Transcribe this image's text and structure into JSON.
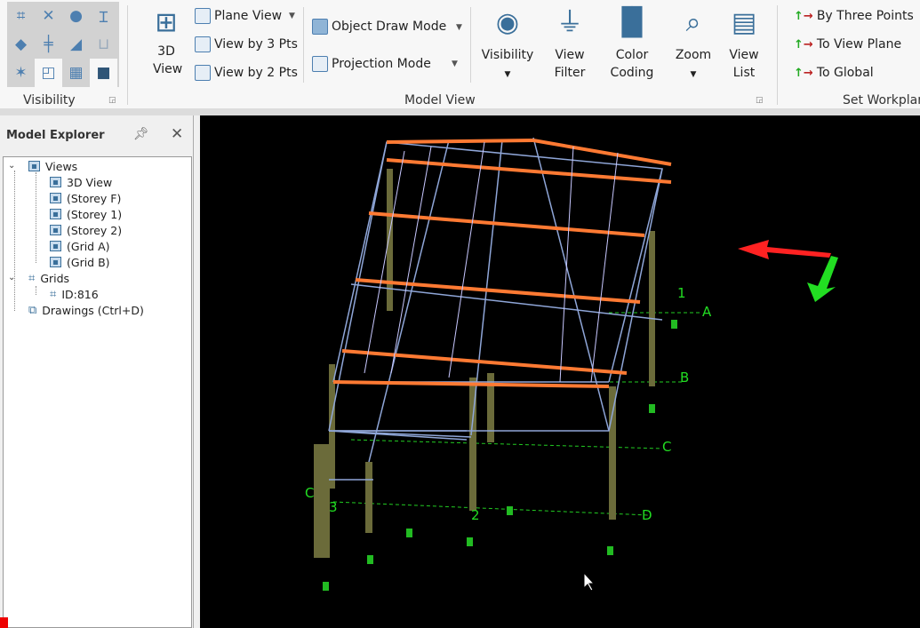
{
  "ribbon": {
    "visibility_group": {
      "label": "Visibility",
      "icons": [
        "grid-node-icon",
        "cross-icon",
        "sphere-icon",
        "i-beam-icon",
        "slab-icon",
        "column-icon",
        "angle-icon",
        "foundation-icon",
        "axis-icon",
        "region-icon",
        "panel-icon",
        "solid-icon"
      ]
    },
    "model_view_group": {
      "label": "Model View",
      "view_3d": "3D View",
      "plane_view": "Plane View",
      "view_3pts": "View by 3 Pts",
      "view_2pts": "View by 2 Pts",
      "object_draw_mode": "Object Draw Mode",
      "projection_mode": "Projection Mode",
      "visibility": "Visibility",
      "view_filter": "View Filter",
      "color_coding": "Color Coding",
      "zoom": "Zoom",
      "view_list": "View List"
    },
    "workplane_group": {
      "label": "Set Workplane",
      "by_three_points": "By Three Points",
      "to_view_plane": "To View Plane",
      "to_global": "To Global"
    }
  },
  "explorer": {
    "title": "Model Explorer",
    "tree": {
      "views": {
        "label": "Views",
        "children": [
          "3D View",
          "(Storey F)",
          "(Storey 1)",
          "(Storey 2)",
          "(Grid A)",
          "(Grid B)"
        ]
      },
      "grids": {
        "label": "Grids",
        "children": [
          "ID:816"
        ]
      },
      "drawings": {
        "label": "Drawings (Ctrl+D)"
      }
    }
  },
  "viewport": {
    "grid_labels": [
      "A",
      "B",
      "C",
      "D",
      "1",
      "2",
      "3",
      "C"
    ],
    "colors": {
      "background": "#000000",
      "rafters": "#ff7a33",
      "columns": "#6b6b3a",
      "grid": "#22cc22",
      "x_axis": "#ff2222",
      "y_axis": "#22dd22"
    }
  }
}
